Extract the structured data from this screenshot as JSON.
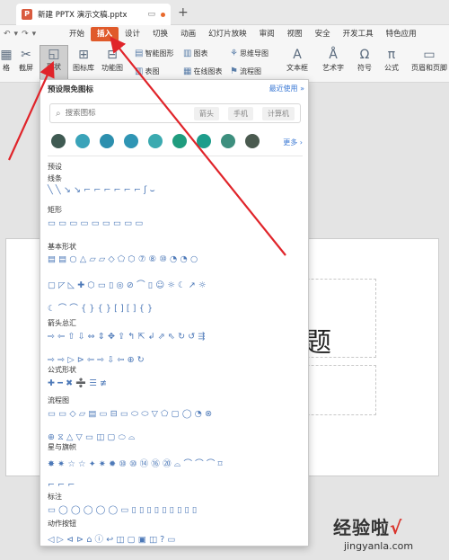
{
  "titlebar": {
    "app_logo": "P",
    "doc_name": "新建 PPTX 演示文稿.pptx",
    "monitor_icon": "monitor-icon",
    "new_tab": "+"
  },
  "menubar": {
    "items": [
      {
        "label": "开始",
        "active": false
      },
      {
        "label": "插入",
        "active": true
      },
      {
        "label": "设计",
        "active": false
      },
      {
        "label": "切换",
        "active": false
      },
      {
        "label": "动画",
        "active": false
      },
      {
        "label": "幻灯片放映",
        "active": false
      },
      {
        "label": "审阅",
        "active": false
      },
      {
        "label": "视图",
        "active": false
      },
      {
        "label": "安全",
        "active": false
      },
      {
        "label": "开发工具",
        "active": false
      },
      {
        "label": "特色应用",
        "active": false
      }
    ],
    "accent": "#e05a2a"
  },
  "ribbon": {
    "table": "格",
    "screenshot": "截屏",
    "shapes": "形状",
    "icon_lib": "图标库",
    "func_chart": "功能图",
    "smart_graphic": "智能图形",
    "chart": "图表",
    "online_chart": "在线图表",
    "table_small": "表图",
    "mindmap": "思维导图",
    "flowchart": "流程图",
    "textbox": "文本框",
    "wordart": "艺术字",
    "symbol": "符号",
    "formula": "公式",
    "header_footer": "页眉和页脚"
  },
  "slide": {
    "title_char": "题"
  },
  "shape_panel": {
    "heading": "预设限免图标",
    "recent": "最近使用 »",
    "search_placeholder": "搜索图标",
    "chips": [
      "箭头",
      "手机",
      "计算机"
    ],
    "more": "更多 ›",
    "preset_label": "预设",
    "icon_colors": [
      "#3f5a52",
      "#3aa3b9",
      "#2c8fae",
      "#2f95b4",
      "#3baab0",
      "#1f9c7e",
      "#1d9d8b",
      "#3d8f7e",
      "#4a5a4f"
    ],
    "sections": [
      {
        "label": "线条",
        "shapes": "╲╲↘↘⌐⌐⌐⌐⌐⌐ʃ⌣"
      },
      {
        "label": "矩形",
        "shapes": "▭▭▭▭▭▭▭▭▭"
      },
      {
        "label": "基本形状",
        "shapes": "▤▤○△▱▱◇⬠⬡⑦⑧⑩◔◔○"
      },
      {
        "label": "",
        "shapes": "▢◸◺✚⬡▭▯◎⊘⌒▯☺☼☾↗☼"
      },
      {
        "label": "",
        "shapes": "☾⌒⌒{}{}[][]{}"
      },
      {
        "label": "箭头总汇",
        "shapes": "⇨⇦⇧⇩⇔⇕✥⇪↰⇱↲⇗⇖↻↺⇶"
      },
      {
        "label": "",
        "shapes": "⇨⇨▷⊳⇦⇨⇩⇦⊕↻"
      },
      {
        "label": "公式形状",
        "shapes": "✚━✖➗☰≢"
      },
      {
        "label": "流程图",
        "shapes": "▭▭◇▱▤▭⊟▭⬭⬭▽⬠▢◯◔⊗"
      },
      {
        "label": "",
        "shapes": "⊕⧖△▽▭◫▢⬭⌓"
      },
      {
        "label": "星与旗帜",
        "shapes": "✸✷☆☆✦✷✹⑩⑩⑭⑯⑳⌓⌒⌒⌒⌑"
      },
      {
        "label": "",
        "shapes": "⌐⌐⌐"
      },
      {
        "label": "标注",
        "shapes": "▭◯◯◯◯◯▭▯▯▯▯▯▯▯▯▯"
      },
      {
        "label": "动作按钮",
        "shapes": "◁▷⊲⊳⌂ⓘ↩◫▢▣◫?▭"
      }
    ]
  },
  "watermark": {
    "text": "经验啦",
    "check": "√",
    "url": "jingyanla.com"
  },
  "colors": {
    "annotation_red": "#e0242a",
    "shape_blue": "#4d79b8"
  }
}
